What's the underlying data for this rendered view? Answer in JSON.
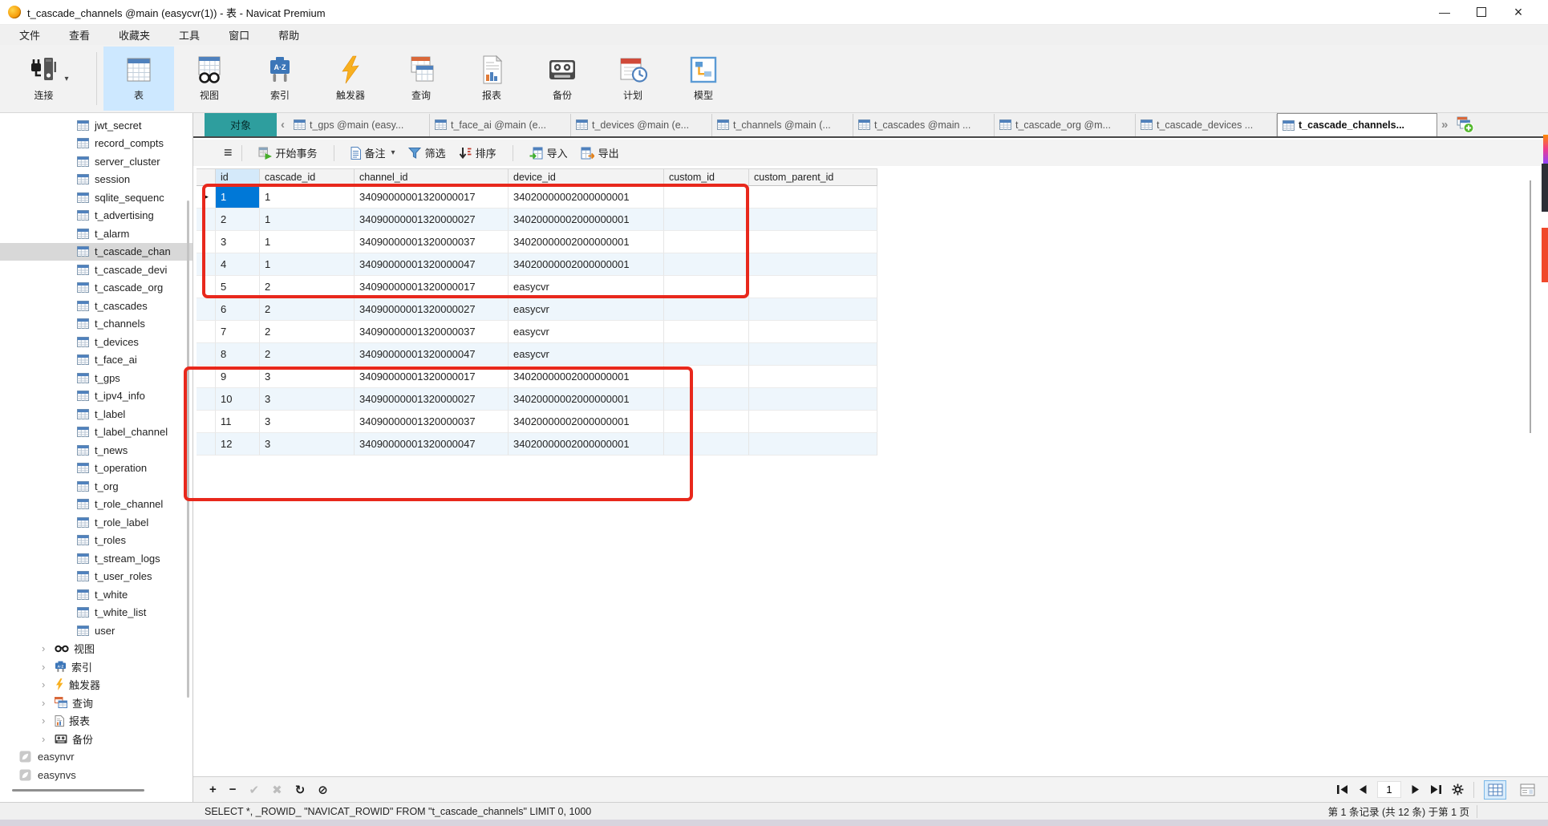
{
  "window": {
    "title": "t_cascade_channels @main (easycvr(1)) - 表 - Navicat Premium",
    "minimize_glyph": "—",
    "close_glyph": "×"
  },
  "menu": {
    "items": [
      "文件",
      "查看",
      "收藏夹",
      "工具",
      "窗口",
      "帮助"
    ]
  },
  "toolbar": {
    "connection": {
      "label": "连接",
      "icon": "connection-icon",
      "caret": "▾"
    },
    "buttons": [
      {
        "label": "表",
        "icon": "table-icon",
        "selected": true
      },
      {
        "label": "视图",
        "icon": "view-icon",
        "selected": false
      },
      {
        "label": "索引",
        "icon": "index-icon",
        "selected": false
      },
      {
        "label": "触发器",
        "icon": "trigger-icon",
        "selected": false
      },
      {
        "label": "查询",
        "icon": "query-icon",
        "selected": false
      },
      {
        "label": "报表",
        "icon": "report-icon",
        "selected": false
      },
      {
        "label": "备份",
        "icon": "backup-icon",
        "selected": false
      },
      {
        "label": "计划",
        "icon": "schedule-icon",
        "selected": false
      },
      {
        "label": "模型",
        "icon": "model-icon",
        "selected": false
      }
    ]
  },
  "sidebar": {
    "tables": [
      "jwt_secret",
      "record_compts",
      "server_cluster",
      "session",
      "sqlite_sequenc",
      "t_advertising",
      "t_alarm",
      "t_cascade_chan",
      "t_cascade_devi",
      "t_cascade_org",
      "t_cascades",
      "t_channels",
      "t_devices",
      "t_face_ai",
      "t_gps",
      "t_ipv4_info",
      "t_label",
      "t_label_channel",
      "t_news",
      "t_operation",
      "t_org",
      "t_role_channel",
      "t_role_label",
      "t_roles",
      "t_stream_logs",
      "t_user_roles",
      "t_white",
      "t_white_list",
      "user"
    ],
    "selected_index": 7,
    "expand_glyph": "›",
    "groups": [
      {
        "label": "视图",
        "icon": "views-icon"
      },
      {
        "label": "索引",
        "icon": "index-small-icon"
      },
      {
        "label": "触发器",
        "icon": "trigger-small-icon"
      },
      {
        "label": "查询",
        "icon": "query-small-icon"
      },
      {
        "label": "报表",
        "icon": "report-small-icon"
      },
      {
        "label": "备份",
        "icon": "backup-small-icon"
      }
    ],
    "connections": [
      "easynvr",
      "easynvs"
    ]
  },
  "tabbar": {
    "object_tab": "对象",
    "scroll_left_glyph": "‹",
    "scroll_right_glyph": "»",
    "tabs": [
      "t_gps @main (easy...",
      "t_face_ai @main (e...",
      "t_devices @main (e...",
      "t_channels @main (...",
      "t_cascades @main ...",
      "t_cascade_org @m...",
      "t_cascade_devices ...",
      "t_cascade_channels..."
    ],
    "active_index": 7
  },
  "grid_toolbar": {
    "menu_glyph": "≡",
    "begin_transaction": "开始事务",
    "note": "备注",
    "note_caret": "▾",
    "filter": "筛选",
    "sort": "排序",
    "import": "导入",
    "export": "导出"
  },
  "grid": {
    "columns": [
      "id",
      "cascade_id",
      "channel_id",
      "device_id",
      "custom_id",
      "custom_parent_id"
    ],
    "row_marker_glyph": "▶",
    "selected_row": 0,
    "rows": [
      [
        "1",
        "1",
        "34090000001320000017",
        "34020000002000000001",
        "",
        ""
      ],
      [
        "2",
        "1",
        "34090000001320000027",
        "34020000002000000001",
        "",
        ""
      ],
      [
        "3",
        "1",
        "34090000001320000037",
        "34020000002000000001",
        "",
        ""
      ],
      [
        "4",
        "1",
        "34090000001320000047",
        "34020000002000000001",
        "",
        ""
      ],
      [
        "5",
        "2",
        "34090000001320000017",
        "easycvr",
        "",
        ""
      ],
      [
        "6",
        "2",
        "34090000001320000027",
        "easycvr",
        "",
        ""
      ],
      [
        "7",
        "2",
        "34090000001320000037",
        "easycvr",
        "",
        ""
      ],
      [
        "8",
        "2",
        "34090000001320000047",
        "easycvr",
        "",
        ""
      ],
      [
        "9",
        "3",
        "34090000001320000017",
        "34020000002000000001",
        "",
        ""
      ],
      [
        "10",
        "3",
        "34090000001320000027",
        "34020000002000000001",
        "",
        ""
      ],
      [
        "11",
        "3",
        "34090000001320000037",
        "34020000002000000001",
        "",
        ""
      ],
      [
        "12",
        "3",
        "34090000001320000047",
        "34020000002000000001",
        "",
        ""
      ]
    ]
  },
  "record_bar": {
    "add_glyph": "+",
    "delete_glyph": "−",
    "apply_glyph": "✔",
    "discard_glyph": "✖",
    "refresh_glyph": "↻",
    "stop_glyph": "⊘",
    "page": "1"
  },
  "status_bar": {
    "sql": "SELECT *, _ROWID_ \"NAVICAT_ROWID\" FROM \"t_cascade_channels\" LIMIT 0, 1000",
    "record_info": "第 1 条记录 (共 12 条) 于第 1 页"
  },
  "colors": {
    "accent_teal": "#2e9e9e",
    "selection_blue": "#0078d7",
    "annotation_red": "#e8281c",
    "toolbar_selected": "#cde8ff"
  }
}
